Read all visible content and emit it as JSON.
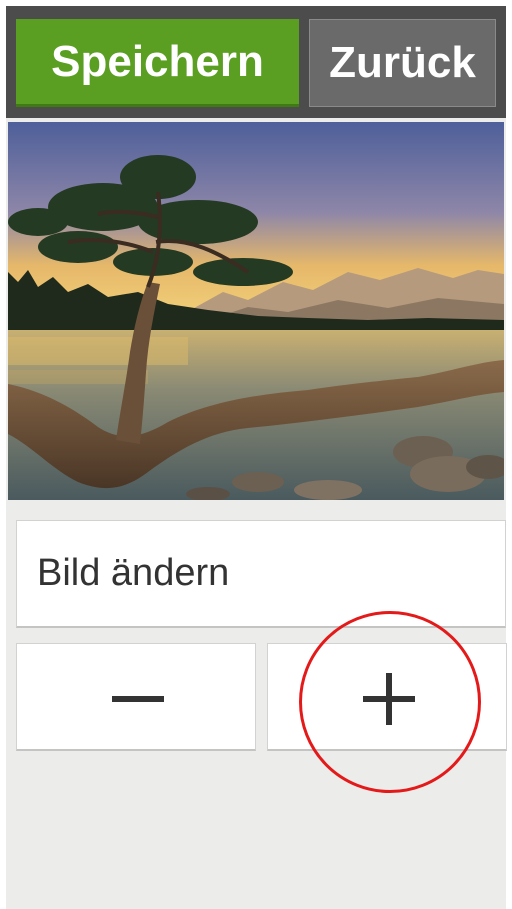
{
  "toolbar": {
    "save_label": "Speichern",
    "back_label": "Zurück",
    "save_color": "#5a9e22"
  },
  "photo": {
    "subject": "landscape-photo-tree-lake-mountains"
  },
  "actions": {
    "change_image_label": "Bild ändern",
    "decrease_icon": "minus-icon",
    "increase_icon": "plus-icon"
  },
  "annotation": {
    "highlight_color": "#e41a1a"
  }
}
